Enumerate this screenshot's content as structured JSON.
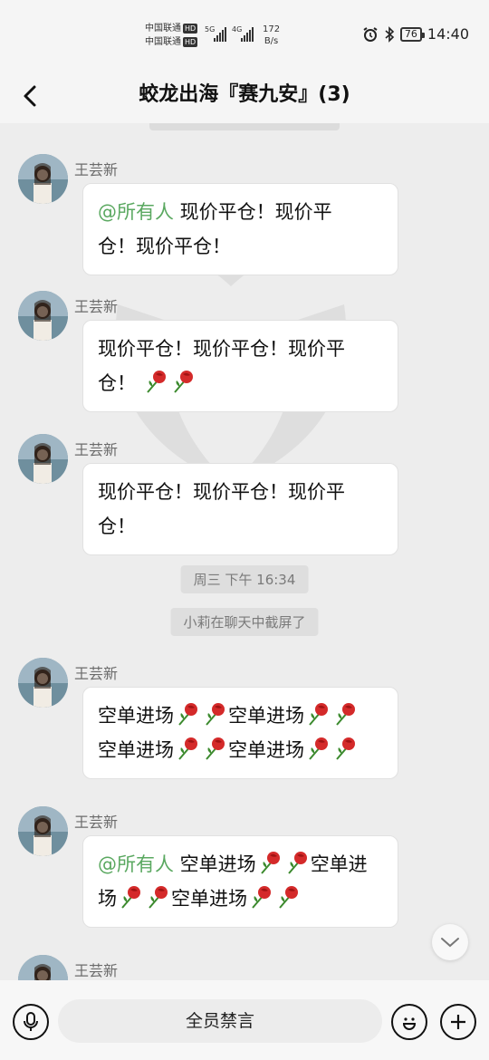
{
  "status_bar": {
    "carrier_1": "中国联通",
    "carrier_2": "中国联通",
    "hd_badge": "HD",
    "net_5g": "5G",
    "net_4g": "4G",
    "speed_value": "172",
    "speed_unit": "B/s",
    "battery": "76",
    "time": "14:40"
  },
  "header": {
    "title": "蛟龙出海『赛九安』(3)"
  },
  "messages": [
    {
      "sender": "王芸新",
      "mention": "@所有人",
      "line1": " 现价平仓！现价平",
      "line2": "仓！现价平仓！"
    },
    {
      "sender": "王芸新",
      "line1": "现价平仓！现价平仓！现价平",
      "line2": "仓！"
    },
    {
      "sender": "王芸新",
      "line1": "现价平仓！现价平仓！现价平",
      "line2": "仓！"
    },
    {
      "sender": "王芸新",
      "a": "空单进场",
      "b": "空单进场",
      "c": "空单进场",
      "d": "空单进场"
    },
    {
      "sender": "王芸新",
      "mention": "@所有人",
      "a": " 空单进场",
      "b": "空单进",
      "c": "场",
      "d": "空单进场"
    },
    {
      "sender": "王芸新"
    }
  ],
  "system": {
    "timestamp": "周三 下午 16:34",
    "screenshot_notice": "小莉在聊天中截屏了"
  },
  "bottom_bar": {
    "mute_label": "全员禁言"
  },
  "icons": {
    "back": "chevron-left-icon",
    "voice": "microphone-icon",
    "emoji": "emoji-icon",
    "more": "plus-icon",
    "scroll": "chevron-down-icon",
    "rose": "rose-emoji"
  }
}
